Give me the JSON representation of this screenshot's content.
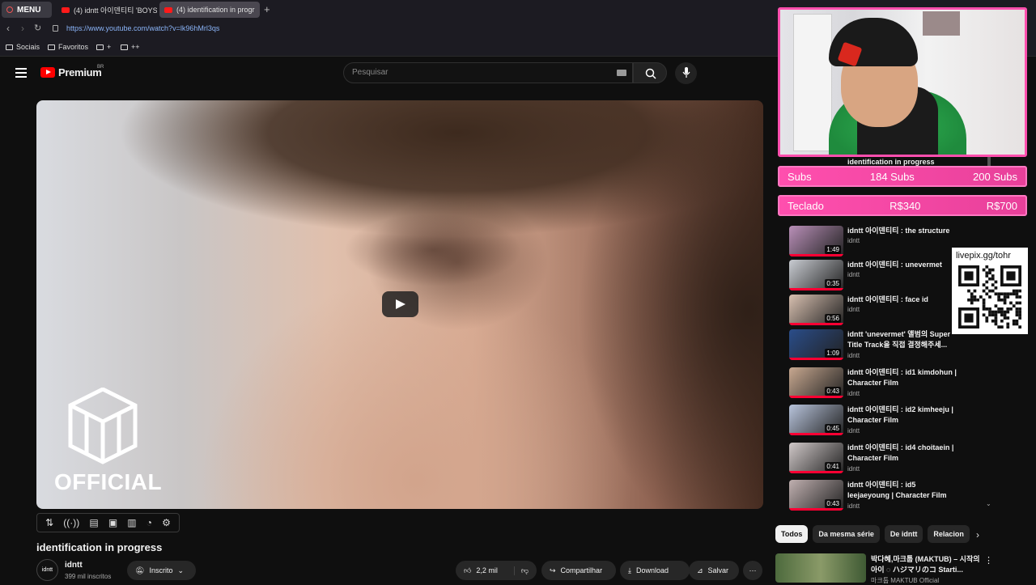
{
  "browser": {
    "menu_label": "MENU",
    "tabs": [
      {
        "label": "(4) idntt 아이덴티티 'BOYS"
      },
      {
        "label": "(4) identification in progr"
      }
    ],
    "new_tab": "+",
    "url": "https://www.youtube.com/watch?v=lk96hMrl3qs",
    "bookmarks": [
      "Sociais",
      "Favoritos",
      "+",
      "++"
    ]
  },
  "youtube": {
    "logo_text": "Premium",
    "logo_region": "BR",
    "search_placeholder": "Pesquisar",
    "player": {
      "watermark_text": "OFFICIAL"
    },
    "video_title": "identification in progress",
    "channel": {
      "avatar_text": "idntt",
      "name": "idntt",
      "subscribers": "399 mil inscritos"
    },
    "actions": {
      "subscribed": "Inscrito",
      "likes": "2,2 mil",
      "share": "Compartilhar",
      "download": "Download",
      "save": "Salvar"
    },
    "chips": [
      "Todos",
      "Da mesma série",
      "De idntt",
      "Relacion"
    ],
    "recommended": {
      "title": "박다혜,마크툽 (MAKTUB) – 시작의 아이 ◌ ハジマリのコ Starti...",
      "channel": "마크툽 MAKTUB Official"
    }
  },
  "playlist": [
    {
      "title": "identification in progress",
      "channel": "",
      "duration": ""
    },
    {
      "title": "idntt 아이덴티티 : the structure",
      "channel": "idntt",
      "duration": "1:49",
      "thumb_color": "#b98fb8"
    },
    {
      "title": "idntt 아이덴티티 : unevermet",
      "channel": "idntt",
      "duration": "0:35",
      "thumb_color": "#c9ccd2"
    },
    {
      "title": "idntt 아이덴티티 : face id",
      "channel": "idntt",
      "duration": "0:56",
      "thumb_color": "#d8c0b0"
    },
    {
      "title": "idntt 'unevermet' 앨범의 Super Title Track을 직접 결정해주세...",
      "channel": "idntt",
      "duration": "1:09",
      "thumb_color": "#2a4d8a"
    },
    {
      "title": "idntt 아이덴티티 : id1 kimdohun | Character Film",
      "channel": "idntt",
      "duration": "0:43",
      "thumb_color": "#c8a890"
    },
    {
      "title": "idntt 아이덴티티 : id2 kimheeju | Character Film",
      "channel": "idntt",
      "duration": "0:45",
      "thumb_color": "#b8c4dc"
    },
    {
      "title": "idntt 아이덴티티 : id4 choitaein | Character Film",
      "channel": "idntt",
      "duration": "0:41",
      "thumb_color": "#d0c8c8"
    },
    {
      "title": "idntt 아이덴티티 : id5 leejaeyoung | Character Film",
      "channel": "idntt",
      "duration": "0:43",
      "thumb_color": "#c0b0b0"
    }
  ],
  "stream_overlay": {
    "subs_goal": {
      "label": "Subs",
      "current": "184 Subs",
      "target": "200 Subs"
    },
    "teclado_goal": {
      "label": "Teclado",
      "current": "R$340",
      "target": "R$700"
    },
    "qr_label": "livepix.gg/tohr",
    "accent_color": "#ff4fae"
  }
}
